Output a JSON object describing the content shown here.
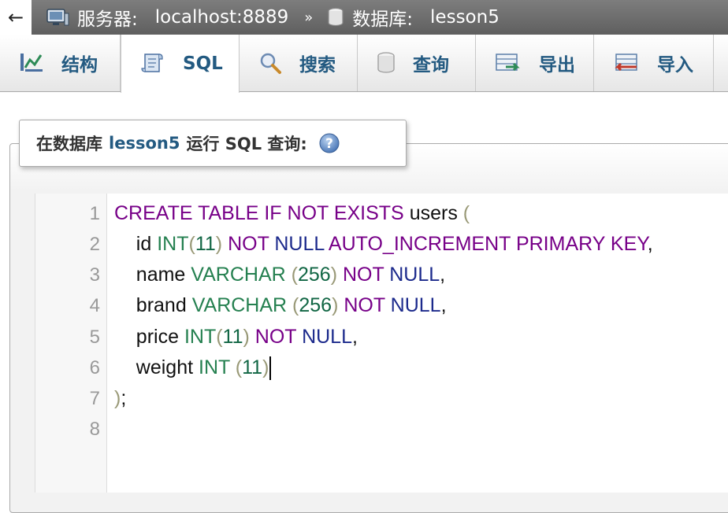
{
  "breadcrumb": {
    "back_glyph": "←",
    "server_label": "服务器:",
    "server_value": "localhost:8889",
    "separator": "»",
    "db_label": "数据库:",
    "db_value": "lesson5",
    "icons": [
      "server-icon",
      "database-icon"
    ]
  },
  "tabs": [
    {
      "label": "结构",
      "icon": "structure-icon",
      "active": false
    },
    {
      "label": "SQL",
      "icon": "sql-icon",
      "active": true
    },
    {
      "label": "搜索",
      "icon": "search-icon",
      "active": false
    },
    {
      "label": "查询",
      "icon": "query-icon",
      "active": false
    },
    {
      "label": "导出",
      "icon": "export-icon",
      "active": false
    },
    {
      "label": "导入",
      "icon": "import-icon",
      "active": false
    }
  ],
  "query_panel": {
    "legend_prefix": "在数据库",
    "legend_db": "lesson5",
    "legend_suffix": "运行 SQL 查询:",
    "help_icon": "help-icon"
  },
  "editor": {
    "line_numbers": [
      "1",
      "2",
      "3",
      "4",
      "5",
      "6",
      "7",
      "8"
    ],
    "lines": [
      "CREATE TABLE IF NOT EXISTS users (",
      "    id INT(11) NOT NULL AUTO_INCREMENT PRIMARY KEY,",
      "    name VARCHAR (256) NOT NULL,",
      "    brand VARCHAR (256) NOT NULL,",
      "    price INT(11) NOT NULL,",
      "    weight INT (11)",
      ");",
      ""
    ]
  },
  "colors": {
    "keyword": "#770088",
    "null_keyword": "#1c2a8c",
    "type": "#258050",
    "number": "#116644",
    "link_blue": "#235a81"
  }
}
